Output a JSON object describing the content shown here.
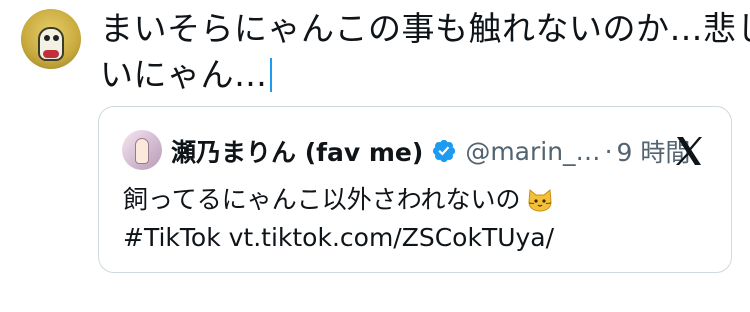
{
  "composer": {
    "line1": "まいそらにゃんこの事も触れないのか…悲し",
    "line2": "いにゃん…"
  },
  "quoted_post": {
    "display_name": "瀬乃まりん (fav me)",
    "handle": "@marin_…",
    "separator": "·",
    "time": "9 時間",
    "text_line1": "飼ってるにゃんこ以外さわれないの",
    "text_line2": "#TikTok vt.tiktok.com/ZSCokTUya/",
    "emoji": "cat-face"
  },
  "icons": {
    "verified": "verified-badge-icon",
    "remove": "close-icon"
  },
  "colors": {
    "accent": "#1d9bf0",
    "text": "#0f1419",
    "secondary_text": "#536471",
    "border": "#cfd9de"
  }
}
